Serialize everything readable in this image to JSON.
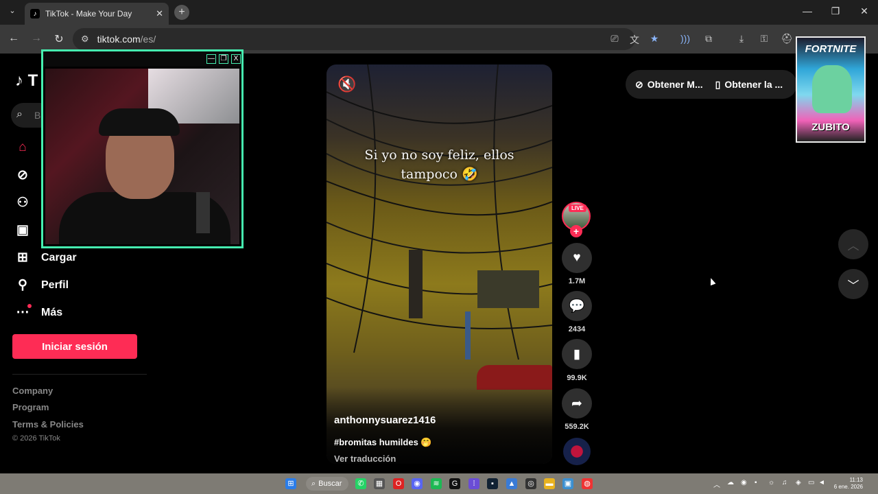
{
  "browser": {
    "tab_title": "TikTok - Make Your Day",
    "url_host": "tiktok.com",
    "url_path": "/es/"
  },
  "sidebar": {
    "logo": "T",
    "search_placeholder": "B",
    "nav": [
      {
        "label": "",
        "icon": "home-icon"
      },
      {
        "label": "",
        "icon": "compass-icon"
      },
      {
        "label": "",
        "icon": "following-icon"
      },
      {
        "label": "",
        "icon": "live-tv-icon"
      },
      {
        "label": "Cargar",
        "icon": "upload-icon"
      },
      {
        "label": "Perfil",
        "icon": "profile-icon"
      },
      {
        "label": "Más",
        "icon": "more-icon"
      }
    ],
    "login_label": "Iniciar sesión",
    "footer_links": [
      "Company",
      "Program",
      "Terms & Policies"
    ],
    "copyright": "© 2026 TikTok"
  },
  "video": {
    "caption_line1": "Si yo no soy feliz, ellos",
    "caption_line2": "tampoco 🤣",
    "author": "anthonnysuarez1416",
    "description": "#bromitas humildes 🤭",
    "translate_label": "Ver traducción",
    "progress": 0.07
  },
  "actions": {
    "live_badge": "LIVE",
    "likes": "1.7M",
    "comments": "2434",
    "saves": "99.9K",
    "shares": "559.2K"
  },
  "promo": {
    "item1": "Obtener M...",
    "item2": "Obtener la ..."
  },
  "overlay": {
    "ad_title": "FORTNITE",
    "ad_code": "ZUBITO"
  },
  "taskbar": {
    "search_label": "Buscar",
    "time": "11:13",
    "date": "6 ene. 2026"
  },
  "colors": {
    "accent": "#fe2c55",
    "cam_border": "#46f0b0"
  }
}
